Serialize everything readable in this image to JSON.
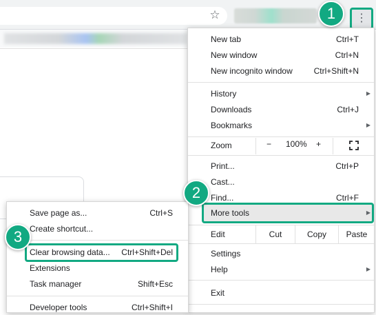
{
  "browser": {
    "star_icon": "star-icon",
    "menu_icon": "three-dot-menu-icon"
  },
  "menu": {
    "items": [
      {
        "label": "New tab",
        "shortcut": "Ctrl+T"
      },
      {
        "label": "New window",
        "shortcut": "Ctrl+N"
      },
      {
        "label": "New incognito window",
        "shortcut": "Ctrl+Shift+N"
      },
      {
        "label": "History",
        "shortcut": ""
      },
      {
        "label": "Downloads",
        "shortcut": "Ctrl+J"
      },
      {
        "label": "Bookmarks",
        "shortcut": ""
      }
    ],
    "zoom": {
      "label": "Zoom",
      "minus": "−",
      "value": "100%",
      "plus": "+"
    },
    "items2": [
      {
        "label": "Print...",
        "shortcut": "Ctrl+P"
      },
      {
        "label": "Cast...",
        "shortcut": ""
      },
      {
        "label": "Find...",
        "shortcut": "Ctrl+F"
      },
      {
        "label": "More tools",
        "shortcut": ""
      }
    ],
    "edit": {
      "label": "Edit",
      "cut": "Cut",
      "copy": "Copy",
      "paste": "Paste"
    },
    "items3": [
      {
        "label": "Settings",
        "shortcut": ""
      },
      {
        "label": "Help",
        "shortcut": ""
      },
      {
        "label": "Exit",
        "shortcut": ""
      }
    ]
  },
  "submenu": {
    "items": [
      {
        "label": "Save page as...",
        "shortcut": "Ctrl+S"
      },
      {
        "label": "Create shortcut...",
        "shortcut": ""
      },
      {
        "label": "Clear browsing data...",
        "shortcut": "Ctrl+Shift+Del"
      },
      {
        "label": "Extensions",
        "shortcut": ""
      },
      {
        "label": "Task manager",
        "shortcut": "Shift+Esc"
      },
      {
        "label": "Developer tools",
        "shortcut": "Ctrl+Shift+I"
      }
    ]
  },
  "callouts": {
    "step1": "1",
    "step2": "2",
    "step3": "3"
  },
  "colors": {
    "accent": "#12a982"
  }
}
